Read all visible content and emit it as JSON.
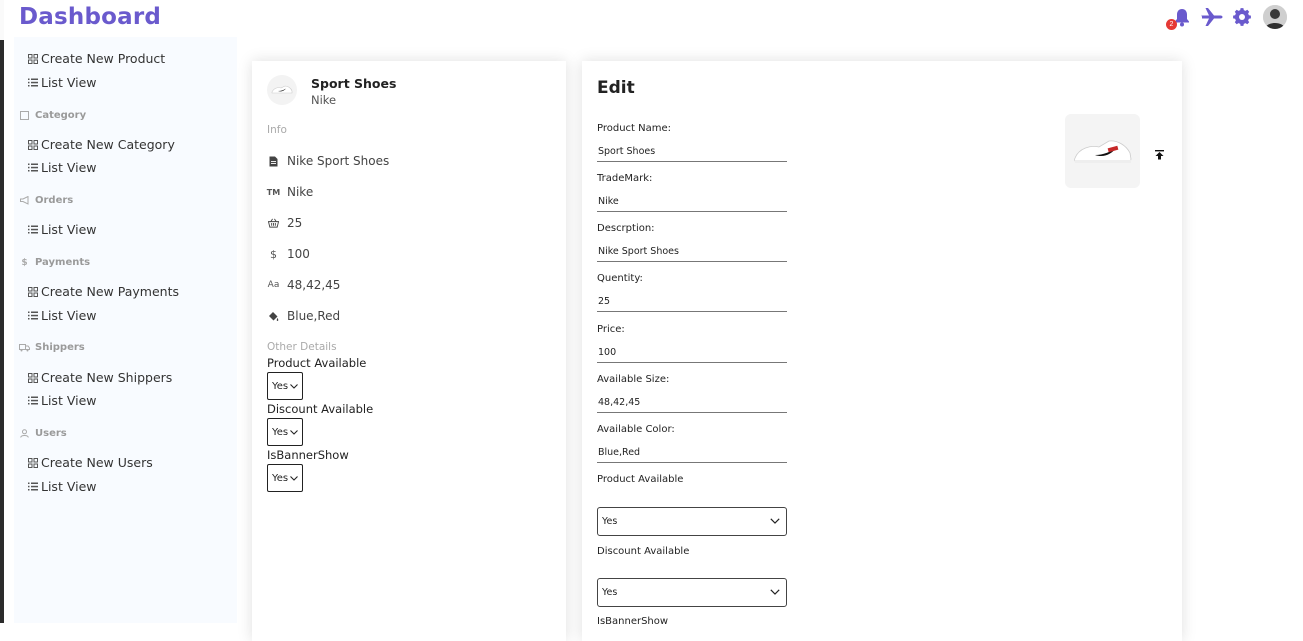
{
  "app": {
    "title": "Dashboard"
  },
  "header": {
    "notification_count": "2"
  },
  "sidebar": {
    "products": [
      {
        "label": "Create New Product"
      },
      {
        "label": "List View"
      }
    ],
    "sections": [
      {
        "heading": "Category",
        "items": [
          {
            "label": "Create New Category"
          },
          {
            "label": "List View"
          }
        ]
      },
      {
        "heading": "Orders",
        "items": [
          {
            "label": "List View"
          }
        ]
      },
      {
        "heading": "Payments",
        "items": [
          {
            "label": "Create New Payments"
          },
          {
            "label": "List View"
          }
        ]
      },
      {
        "heading": "Shippers",
        "items": [
          {
            "label": "Create New Shippers"
          },
          {
            "label": "List View"
          }
        ]
      },
      {
        "heading": "Users",
        "items": [
          {
            "label": "Create New Users"
          },
          {
            "label": "List View"
          }
        ]
      }
    ]
  },
  "product": {
    "name": "Sport Shoes",
    "brand": "Nike",
    "info_heading": "Info",
    "info": {
      "description": "Nike Sport Shoes",
      "trademark": "Nike",
      "quantity": "25",
      "price": "100",
      "sizes": "48,42,45",
      "colors": "Blue,Red"
    },
    "other_heading": "Other Details",
    "other": [
      {
        "label": "Product Available",
        "value": "Yes"
      },
      {
        "label": "Discount Available",
        "value": "Yes"
      },
      {
        "label": "IsBannerShow",
        "value": "Yes"
      }
    ]
  },
  "edit": {
    "title": "Edit",
    "fields": [
      {
        "label": "Product Name:",
        "value": "Sport Shoes"
      },
      {
        "label": "TradeMark:",
        "value": "Nike"
      },
      {
        "label": "Descrption:",
        "value": "Nike Sport Shoes"
      },
      {
        "label": "Quentity:",
        "value": "25"
      },
      {
        "label": "Price:",
        "value": "100"
      },
      {
        "label": "Available Size:",
        "value": "48,42,45"
      },
      {
        "label": "Available Color:",
        "value": "Blue,Red"
      }
    ],
    "selects": [
      {
        "label": "Product Available",
        "value": "Yes"
      },
      {
        "label": "Discount Available",
        "value": "Yes"
      },
      {
        "label": "IsBannerShow",
        "value": ""
      }
    ]
  },
  "colors": {
    "brand": "#6a5acd",
    "badge": "#e53935",
    "sidebar_bg": "#f8fbff"
  },
  "icons": [
    "bell-icon",
    "airplane-icon",
    "gear-icon",
    "avatar",
    "grid-icon",
    "list-icon",
    "upload-icon",
    "file-icon",
    "trademark-icon",
    "basket-icon",
    "dollar-icon",
    "font-size-icon",
    "paint-bucket-icon",
    "chevron-down-icon"
  ]
}
